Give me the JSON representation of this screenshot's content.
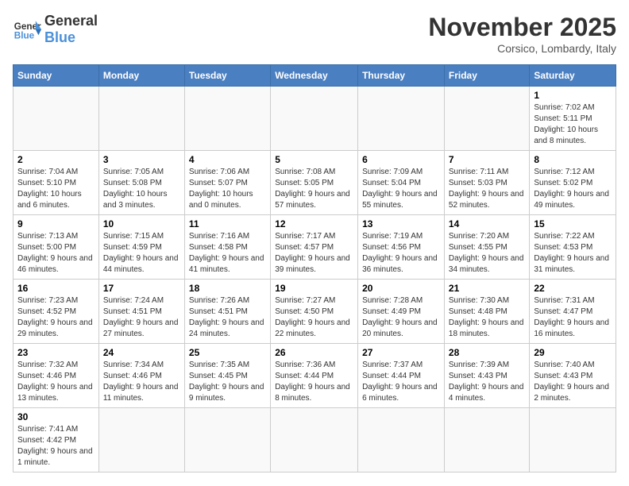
{
  "header": {
    "logo_general": "General",
    "logo_blue": "Blue",
    "month_title": "November 2025",
    "location": "Corsico, Lombardy, Italy"
  },
  "days_of_week": [
    "Sunday",
    "Monday",
    "Tuesday",
    "Wednesday",
    "Thursday",
    "Friday",
    "Saturday"
  ],
  "weeks": [
    [
      {
        "num": "",
        "info": ""
      },
      {
        "num": "",
        "info": ""
      },
      {
        "num": "",
        "info": ""
      },
      {
        "num": "",
        "info": ""
      },
      {
        "num": "",
        "info": ""
      },
      {
        "num": "",
        "info": ""
      },
      {
        "num": "1",
        "info": "Sunrise: 7:02 AM\nSunset: 5:11 PM\nDaylight: 10 hours and 8 minutes."
      }
    ],
    [
      {
        "num": "2",
        "info": "Sunrise: 7:04 AM\nSunset: 5:10 PM\nDaylight: 10 hours and 6 minutes."
      },
      {
        "num": "3",
        "info": "Sunrise: 7:05 AM\nSunset: 5:08 PM\nDaylight: 10 hours and 3 minutes."
      },
      {
        "num": "4",
        "info": "Sunrise: 7:06 AM\nSunset: 5:07 PM\nDaylight: 10 hours and 0 minutes."
      },
      {
        "num": "5",
        "info": "Sunrise: 7:08 AM\nSunset: 5:05 PM\nDaylight: 9 hours and 57 minutes."
      },
      {
        "num": "6",
        "info": "Sunrise: 7:09 AM\nSunset: 5:04 PM\nDaylight: 9 hours and 55 minutes."
      },
      {
        "num": "7",
        "info": "Sunrise: 7:11 AM\nSunset: 5:03 PM\nDaylight: 9 hours and 52 minutes."
      },
      {
        "num": "8",
        "info": "Sunrise: 7:12 AM\nSunset: 5:02 PM\nDaylight: 9 hours and 49 minutes."
      }
    ],
    [
      {
        "num": "9",
        "info": "Sunrise: 7:13 AM\nSunset: 5:00 PM\nDaylight: 9 hours and 46 minutes."
      },
      {
        "num": "10",
        "info": "Sunrise: 7:15 AM\nSunset: 4:59 PM\nDaylight: 9 hours and 44 minutes."
      },
      {
        "num": "11",
        "info": "Sunrise: 7:16 AM\nSunset: 4:58 PM\nDaylight: 9 hours and 41 minutes."
      },
      {
        "num": "12",
        "info": "Sunrise: 7:17 AM\nSunset: 4:57 PM\nDaylight: 9 hours and 39 minutes."
      },
      {
        "num": "13",
        "info": "Sunrise: 7:19 AM\nSunset: 4:56 PM\nDaylight: 9 hours and 36 minutes."
      },
      {
        "num": "14",
        "info": "Sunrise: 7:20 AM\nSunset: 4:55 PM\nDaylight: 9 hours and 34 minutes."
      },
      {
        "num": "15",
        "info": "Sunrise: 7:22 AM\nSunset: 4:53 PM\nDaylight: 9 hours and 31 minutes."
      }
    ],
    [
      {
        "num": "16",
        "info": "Sunrise: 7:23 AM\nSunset: 4:52 PM\nDaylight: 9 hours and 29 minutes."
      },
      {
        "num": "17",
        "info": "Sunrise: 7:24 AM\nSunset: 4:51 PM\nDaylight: 9 hours and 27 minutes."
      },
      {
        "num": "18",
        "info": "Sunrise: 7:26 AM\nSunset: 4:51 PM\nDaylight: 9 hours and 24 minutes."
      },
      {
        "num": "19",
        "info": "Sunrise: 7:27 AM\nSunset: 4:50 PM\nDaylight: 9 hours and 22 minutes."
      },
      {
        "num": "20",
        "info": "Sunrise: 7:28 AM\nSunset: 4:49 PM\nDaylight: 9 hours and 20 minutes."
      },
      {
        "num": "21",
        "info": "Sunrise: 7:30 AM\nSunset: 4:48 PM\nDaylight: 9 hours and 18 minutes."
      },
      {
        "num": "22",
        "info": "Sunrise: 7:31 AM\nSunset: 4:47 PM\nDaylight: 9 hours and 16 minutes."
      }
    ],
    [
      {
        "num": "23",
        "info": "Sunrise: 7:32 AM\nSunset: 4:46 PM\nDaylight: 9 hours and 13 minutes."
      },
      {
        "num": "24",
        "info": "Sunrise: 7:34 AM\nSunset: 4:46 PM\nDaylight: 9 hours and 11 minutes."
      },
      {
        "num": "25",
        "info": "Sunrise: 7:35 AM\nSunset: 4:45 PM\nDaylight: 9 hours and 9 minutes."
      },
      {
        "num": "26",
        "info": "Sunrise: 7:36 AM\nSunset: 4:44 PM\nDaylight: 9 hours and 8 minutes."
      },
      {
        "num": "27",
        "info": "Sunrise: 7:37 AM\nSunset: 4:44 PM\nDaylight: 9 hours and 6 minutes."
      },
      {
        "num": "28",
        "info": "Sunrise: 7:39 AM\nSunset: 4:43 PM\nDaylight: 9 hours and 4 minutes."
      },
      {
        "num": "29",
        "info": "Sunrise: 7:40 AM\nSunset: 4:43 PM\nDaylight: 9 hours and 2 minutes."
      }
    ],
    [
      {
        "num": "30",
        "info": "Sunrise: 7:41 AM\nSunset: 4:42 PM\nDaylight: 9 hours and 1 minute."
      },
      {
        "num": "",
        "info": ""
      },
      {
        "num": "",
        "info": ""
      },
      {
        "num": "",
        "info": ""
      },
      {
        "num": "",
        "info": ""
      },
      {
        "num": "",
        "info": ""
      },
      {
        "num": "",
        "info": ""
      }
    ]
  ]
}
